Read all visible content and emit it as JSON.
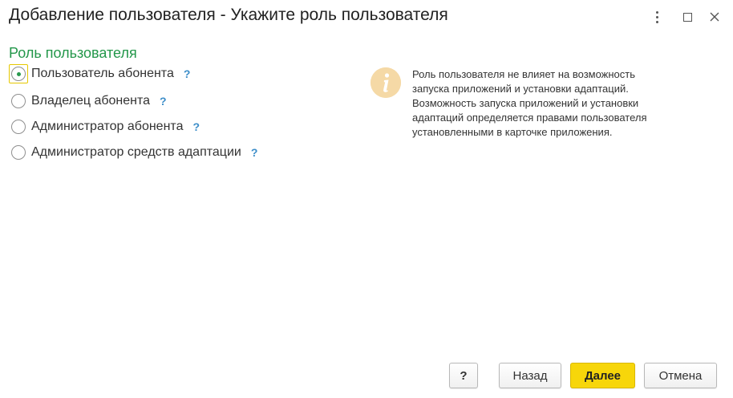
{
  "window": {
    "title": "Добавление пользователя - Укажите роль пользователя"
  },
  "section": {
    "title": "Роль пользователя"
  },
  "roles": [
    {
      "label": "Пользователь абонента",
      "checked": true,
      "help": "?"
    },
    {
      "label": "Владелец абонента",
      "checked": false,
      "help": "?"
    },
    {
      "label": "Администратор абонента",
      "checked": false,
      "help": "?"
    },
    {
      "label": "Администратор средств адаптации",
      "checked": false,
      "help": "?"
    }
  ],
  "info": {
    "icon": "info-icon",
    "lines": [
      "Роль пользователя не влияет на возможность",
      "запуска приложений и установки адаптаций.",
      "Возможность запуска приложений и установки",
      "адаптаций определяется правами пользователя",
      "установленными в карточке приложения."
    ]
  },
  "buttons": {
    "help": "?",
    "back": "Назад",
    "next": "Далее",
    "cancel": "Отмена"
  },
  "colors": {
    "section_title": "#23974a",
    "help_mark": "#3d8ec9",
    "primary_button": "#f7d60a",
    "info_icon_bg": "#f5d9a6"
  }
}
